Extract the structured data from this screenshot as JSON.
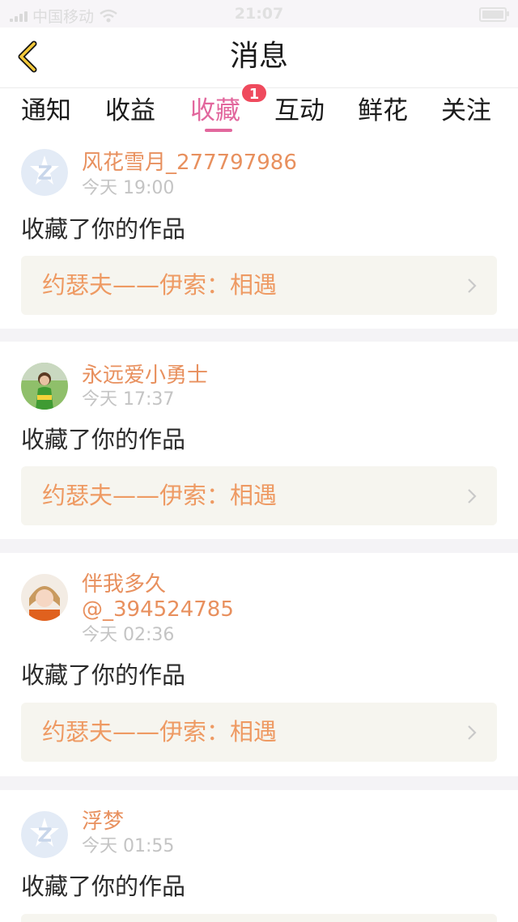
{
  "status_bar": {
    "carrier": "中国移动",
    "time": "21:07"
  },
  "header": {
    "title": "消息"
  },
  "tabs": [
    {
      "label": "通知"
    },
    {
      "label": "收益"
    },
    {
      "label": "收藏",
      "active": true,
      "badge": "1"
    },
    {
      "label": "互动"
    },
    {
      "label": "鲜花"
    },
    {
      "label": "关注"
    }
  ],
  "messages": [
    {
      "user": "风花雪月_277797986",
      "time": "今天 19:00",
      "action": "收藏了你的作品",
      "work": "约瑟夫——伊索：相遇",
      "avatar": "default-avatar-icon"
    },
    {
      "user": "永远爱小勇士",
      "time": "今天 17:37",
      "action": "收藏了你的作品",
      "work": "约瑟夫——伊索：相遇",
      "avatar": "photo-avatar"
    },
    {
      "user_line1": "伴我多久",
      "user_line2": "@_394524785",
      "time": "今天 02:36",
      "action": "收藏了你的作品",
      "work": "约瑟夫——伊索：相遇",
      "avatar": "photo-avatar"
    },
    {
      "user": "浮梦",
      "time": "今天 01:55",
      "action": "收藏了你的作品",
      "avatar": "default-avatar-icon"
    }
  ],
  "colors": {
    "accent_pink": "#e2679d",
    "name_orange": "#e8905e",
    "work_orange": "#ee9a63",
    "badge_red": "#ef4a5d"
  }
}
